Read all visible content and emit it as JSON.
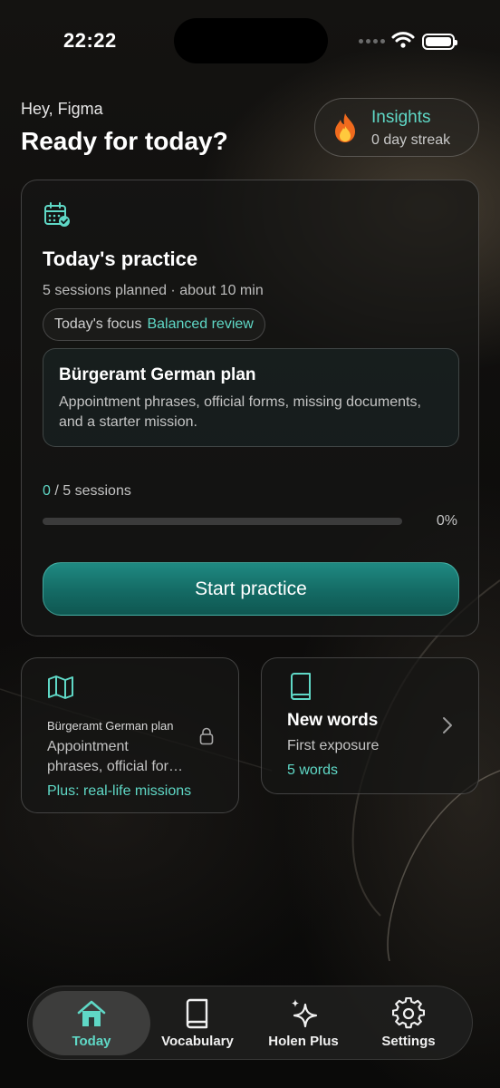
{
  "status_bar": {
    "time": "22:22"
  },
  "header": {
    "greeting": "Hey, Figma",
    "headline": "Ready for today?",
    "insights_title": "Insights",
    "insights_sub": "0 day streak"
  },
  "practice": {
    "title": "Today's practice",
    "subtitle": "5 sessions planned · about 10 min",
    "focus_label": "Today's focus",
    "focus_value": "Balanced review",
    "plan_title": "Bürgeramt German plan",
    "plan_desc": "Appointment phrases, official forms, missing documents, and a starter mission.",
    "progress_done": "0",
    "progress_total": " / 5 sessions",
    "progress_fraction": 0,
    "progress_percent": "0%",
    "start_label": "Start practice"
  },
  "plan_card": {
    "title": "Bürgeramt German plan",
    "desc_line1": "Appointment",
    "desc_line2": "phrases, official forms, missing documents",
    "plus": "Plus: real-life missions"
  },
  "words_card": {
    "title": "New words",
    "subtitle": "First exposure",
    "count": "5 words"
  },
  "tabs": [
    {
      "label": "Today",
      "icon": "house-icon"
    },
    {
      "label": "Vocabulary",
      "icon": "book-icon"
    },
    {
      "label": "Holen Plus",
      "icon": "sparkles-icon"
    },
    {
      "label": "Settings",
      "icon": "gear-icon"
    }
  ],
  "colors": {
    "accent": "#5fd8c6",
    "button": "#1f8a82"
  }
}
